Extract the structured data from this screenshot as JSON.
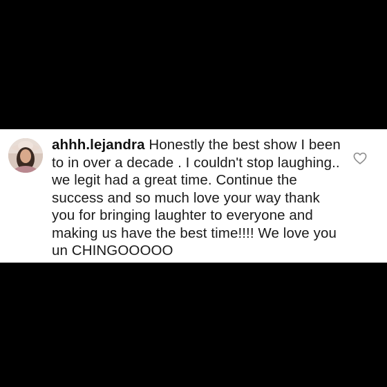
{
  "comment": {
    "username": "ahhh.lejandra",
    "body": "Honestly the best show I been to in over a decade . I couldn't stop laughing.. we legit had a great time. Continue the success and so much love your way thank you for bringing laughter to everyone and making us have the best time!!!! We love you un CHINGOOOOO",
    "avatar_icon": "profile-photo",
    "like_icon": "heart-outline-icon"
  },
  "colors": {
    "background": "#000000",
    "card": "#ffffff",
    "text": "#1a1a1a",
    "icon": "#8e8e8e"
  }
}
